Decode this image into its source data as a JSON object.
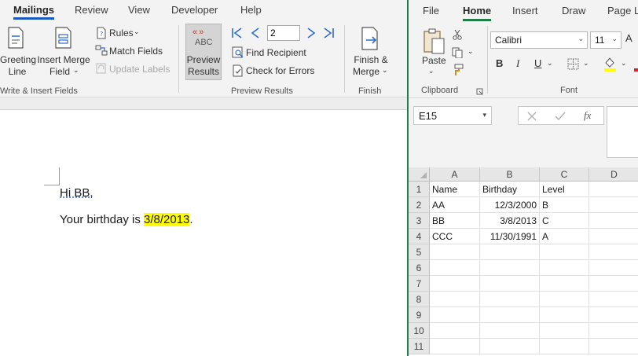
{
  "word": {
    "tabs": [
      "Mailings",
      "Review",
      "View",
      "Developer",
      "Help"
    ],
    "active_tab": "Mailings",
    "ribbon": {
      "greeting_line": [
        "Greeting",
        "Line"
      ],
      "insert_merge_field": [
        "Insert Merge",
        "Field"
      ],
      "rules": "Rules",
      "match_fields": "Match Fields",
      "update_labels": "Update Labels",
      "group_write_insert": "Write & Insert Fields",
      "abc_chevrons": "«»",
      "abc": "ABC",
      "preview_results_btn": [
        "Preview",
        "Results"
      ],
      "record_number": "2",
      "find_recipient": "Find Recipient",
      "check_for_errors": "Check for Errors",
      "group_preview": "Preview Results",
      "finish_merge": [
        "Finish &",
        "Merge"
      ],
      "group_finish": "Finish"
    },
    "document": {
      "greeting": "Hi BB,",
      "line_prefix": "Your birthday is ",
      "line_value": "3/8/2013",
      "line_suffix": "."
    }
  },
  "excel": {
    "tabs": [
      "File",
      "Home",
      "Insert",
      "Draw",
      "Page L"
    ],
    "active_tab": "Home",
    "ribbon": {
      "paste": "Paste",
      "group_clipboard": "Clipboard",
      "font_name": "Calibri",
      "font_size": "11",
      "bold": "B",
      "italic": "I",
      "underline": "U",
      "group_font": "Font"
    },
    "name_box": "E15",
    "fx": "fx",
    "columns": [
      "A",
      "B",
      "C",
      "D"
    ],
    "rows": [
      {
        "n": "1",
        "cells": [
          "Name",
          "Birthday",
          "Level",
          ""
        ]
      },
      {
        "n": "2",
        "cells": [
          "AA",
          "12/3/2000",
          "B",
          ""
        ]
      },
      {
        "n": "3",
        "cells": [
          "BB",
          "3/8/2013",
          "C",
          ""
        ]
      },
      {
        "n": "4",
        "cells": [
          "CCC",
          "11/30/1991",
          "A",
          ""
        ]
      },
      {
        "n": "5",
        "cells": [
          "",
          "",
          "",
          ""
        ]
      },
      {
        "n": "6",
        "cells": [
          "",
          "",
          "",
          ""
        ]
      },
      {
        "n": "7",
        "cells": [
          "",
          "",
          "",
          ""
        ]
      },
      {
        "n": "8",
        "cells": [
          "",
          "",
          "",
          ""
        ]
      },
      {
        "n": "9",
        "cells": [
          "",
          "",
          "",
          ""
        ]
      },
      {
        "n": "10",
        "cells": [
          "",
          "",
          "",
          ""
        ]
      },
      {
        "n": "11",
        "cells": [
          "",
          "",
          "",
          ""
        ]
      }
    ],
    "colors": {
      "accent": "#1f7d48",
      "highlight": "#ffff00",
      "font_color": "#e02020"
    }
  }
}
